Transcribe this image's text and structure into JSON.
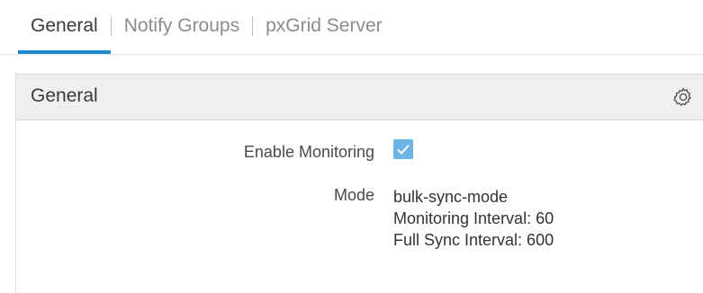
{
  "tabs": [
    {
      "label": "General",
      "active": true
    },
    {
      "label": "Notify Groups",
      "active": false
    },
    {
      "label": "pxGrid Server",
      "active": false
    }
  ],
  "panel": {
    "title": "General",
    "settings_icon": "gear-icon"
  },
  "fields": {
    "enable_monitoring": {
      "label": "Enable Monitoring",
      "checked": true
    },
    "mode": {
      "label": "Mode",
      "lines": [
        "bulk-sync-mode",
        "Monitoring Interval: 60",
        "Full Sync Interval: 600"
      ]
    }
  },
  "colors": {
    "accent": "#1f8ad1",
    "checkbox": "#6cb3e6",
    "header_bg": "#efefef"
  }
}
